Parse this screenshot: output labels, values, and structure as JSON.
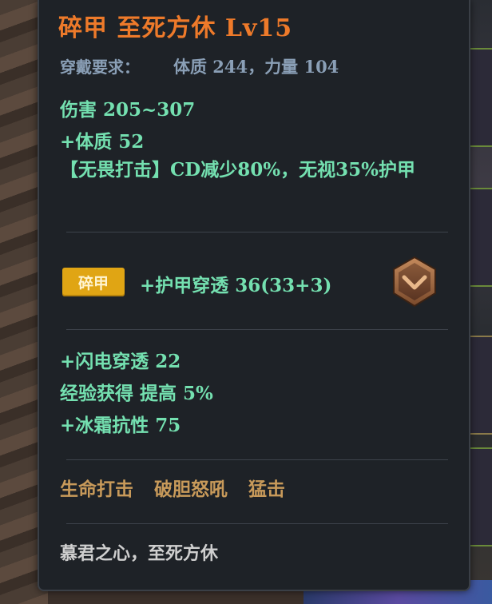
{
  "item": {
    "title": "碎甲  至死方休  Lv15",
    "requirement_label": "穿戴要求：",
    "requirement_value": "体质 244，力量 104",
    "damage": "伤害   205~307",
    "vitality": "+体质  52",
    "special": "【无畏打击】CD减少80%，无视35%护甲",
    "set_badge": "碎甲",
    "armor_pen": "+护甲穿透  36(33+3)",
    "lightning_pen": "+闪电穿透  22",
    "exp_gain": "经验获得  提高  5%",
    "frost_res": "+冰霜抗性  75",
    "skills": [
      "生命打击",
      "破胆怒吼",
      "猛击"
    ],
    "lore": "慕君之心，至死方休"
  },
  "colors": {
    "title": "#ee7a2a",
    "stat": "#74e0b0",
    "requirement": "#8a9fb6",
    "skill": "#c89a5a",
    "badge": "#e0a514",
    "panel": "#1e2227"
  },
  "icons": {
    "rank": "bronze-shield-chevron-icon"
  }
}
